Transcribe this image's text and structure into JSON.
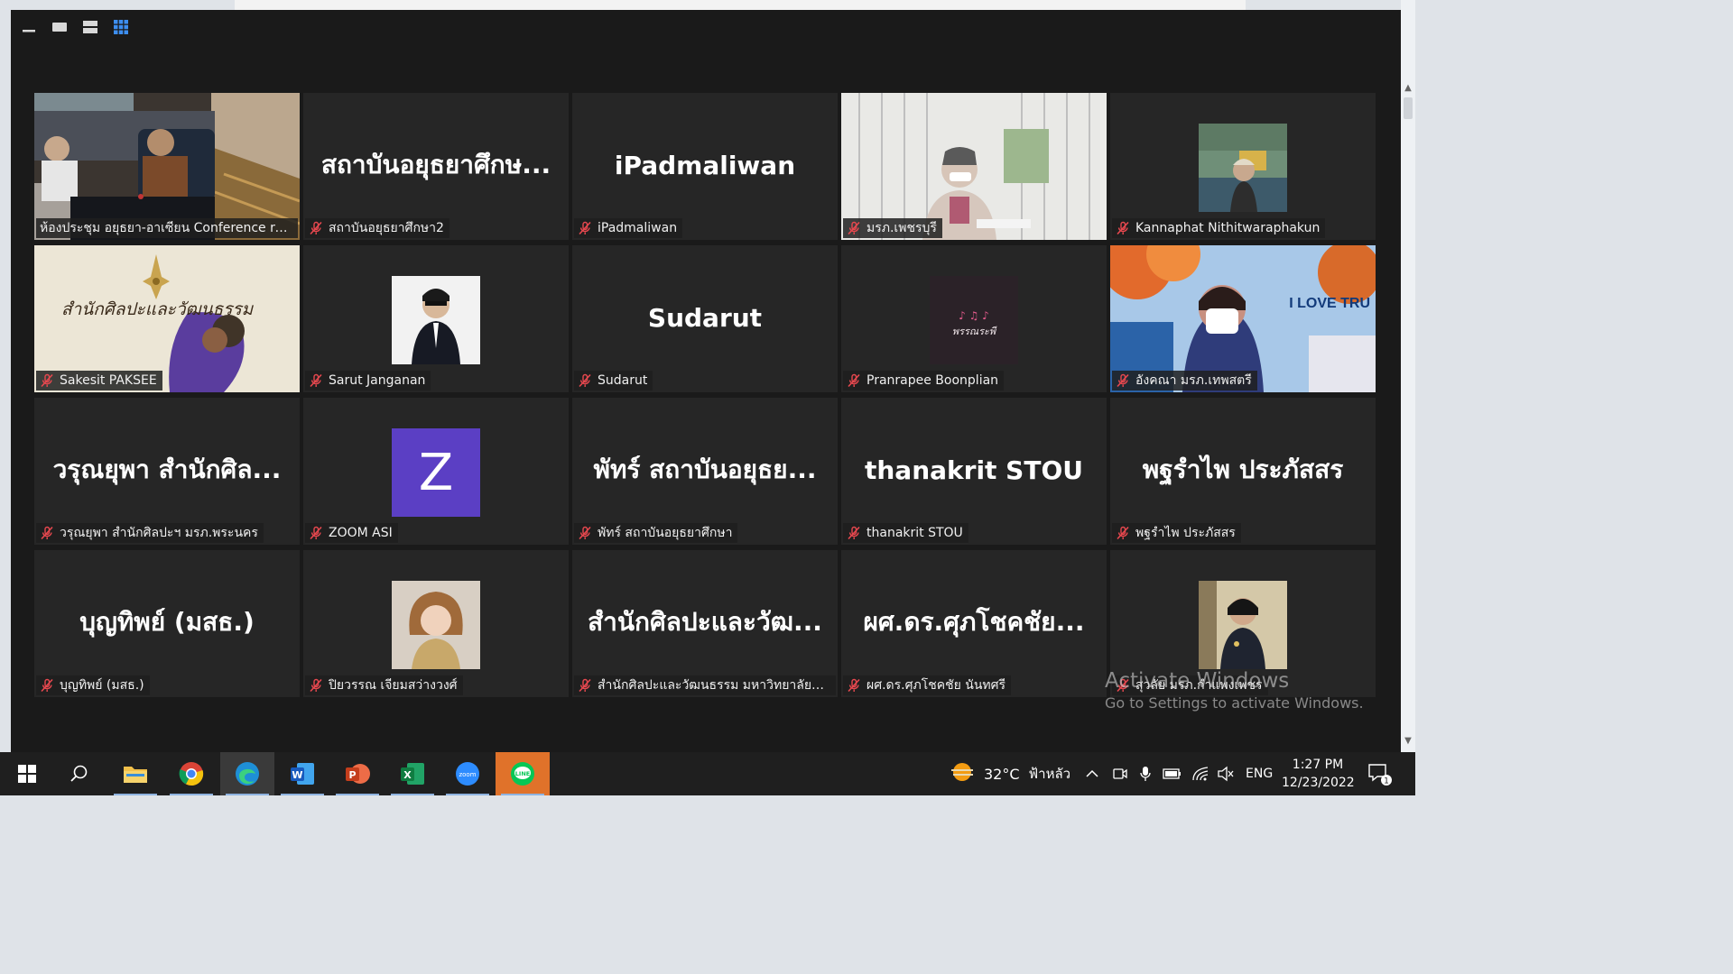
{
  "view_toolbar": [
    "minimize-icon",
    "speaker-view-icon",
    "stacked-view-icon",
    "gallery-view-icon"
  ],
  "participants": [
    {
      "type": "video",
      "scene": "conference",
      "label": "ห้องประชุม อยุธยา-อาเซียน Conference room",
      "active": true
    },
    {
      "type": "name",
      "display": "สถาบันอยุธยาศึกษ...",
      "label": "สถาบันอยุธยาศึกษา2"
    },
    {
      "type": "name",
      "display": "iPadmaliwan",
      "label": "iPadmaliwan"
    },
    {
      "type": "video",
      "scene": "window",
      "label": "มรภ.เพชรบุรี"
    },
    {
      "type": "photo",
      "scene": "landscape",
      "label": "Kannaphat Nithitwaraphakun"
    },
    {
      "type": "video",
      "scene": "culture",
      "label": "Sakesit PAKSEE",
      "overlay": "สำนักศิลปะและวัฒนธรรม"
    },
    {
      "type": "photo",
      "scene": "suit",
      "label": "Sarut Janganan"
    },
    {
      "type": "name",
      "display": "Sudarut",
      "label": "Sudarut"
    },
    {
      "type": "photo",
      "scene": "logo",
      "label": "Pranrapee Boonplian",
      "overlay": "พรรณระพี"
    },
    {
      "type": "video",
      "scene": "tru",
      "label": "อังคณา มรภ.เทพสตรี",
      "overlay": "I LOVE TRU"
    },
    {
      "type": "name",
      "display": "วรุณยุพา สำนักศิล...",
      "label": "วรุณยุพา สำนักศิลปะฯ  มรภ.พระนคร"
    },
    {
      "type": "photo",
      "scene": "z",
      "label": "ZOOM ASI",
      "overlay": "Z"
    },
    {
      "type": "name",
      "display": "พัทร์ สถาบันอยุธย...",
      "label": "พัทร์ สถาบันอยุธยาศึกษา"
    },
    {
      "type": "name",
      "display": "thanakrit STOU",
      "label": "thanakrit STOU"
    },
    {
      "type": "name",
      "display": "พฐรำไพ ประภัสสร",
      "label": "พฐรำไพ ประภัสสร"
    },
    {
      "type": "name",
      "display": "บุญทิพย์ (มสธ.)",
      "label": "บุญทิพย์ (มสธ.)"
    },
    {
      "type": "photo",
      "scene": "woman",
      "label": "ปิยวรรณ เจียมสว่างวงศ์"
    },
    {
      "type": "name",
      "display": "สำนักศิลปะและวัฒ...",
      "label": "สำนักศิลปะและวัฒนธรรม มหาวิทยาลัยราช..."
    },
    {
      "type": "name",
      "display": "ผศ.ดร.ศุภโชคชัย...",
      "label": "ผศ.ดร.ศุภโชคชัย นันทศรี"
    },
    {
      "type": "photo",
      "scene": "portrait",
      "label": "สุวลัย มรภ.กำแพงเพชร"
    }
  ],
  "watermark": {
    "line1": "Activate Windows",
    "line2": "Go to Settings to activate Windows."
  },
  "taskbar": {
    "apps": [
      "start-icon",
      "search-icon",
      "file-explorer-icon",
      "chrome-icon",
      "edge-icon",
      "word-icon",
      "powerpoint-icon",
      "excel-icon",
      "zoom-icon",
      "line-icon"
    ],
    "weather_temp": "32°C",
    "weather_text": "ฟ้าหลัว",
    "language": "ENG",
    "time": "1:27 PM",
    "date": "12/23/2022",
    "notification_count": "1"
  },
  "colors": {
    "tile": "#262626",
    "window": "#1a1a1a",
    "active_outline": "#d8d27a",
    "muted_mic": "#e8484f",
    "taskbar": "#1f1f1f"
  }
}
